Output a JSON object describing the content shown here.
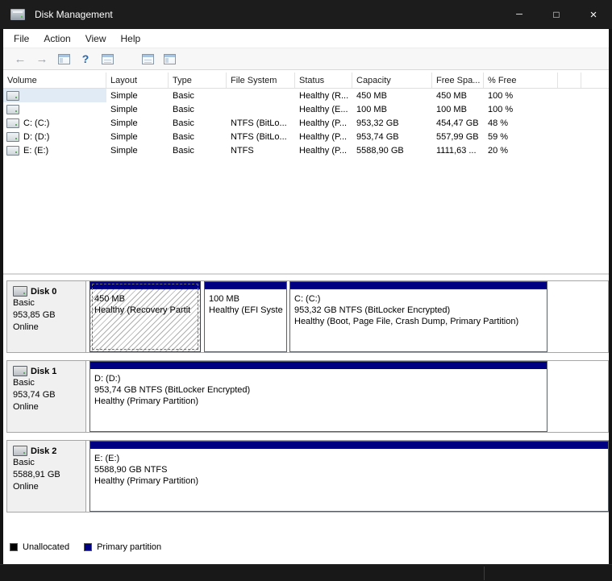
{
  "titlebar": {
    "title": "Disk Management",
    "minimize_glyph": "─",
    "maximize_glyph": "□",
    "close_glyph": "×"
  },
  "menubar": {
    "file": "File",
    "action": "Action",
    "view": "View",
    "help": "Help"
  },
  "toolbar": {
    "back_glyph": "←",
    "forward_glyph": "→",
    "help_glyph": "?",
    "icons": [
      "back-icon",
      "forward-icon",
      "console-tree-icon",
      "help-icon",
      "details-view-icon",
      "properties-icon",
      "action-pane-icon"
    ]
  },
  "volume_list": {
    "columns": {
      "volume": "Volume",
      "layout": "Layout",
      "type": "Type",
      "file_system": "File System",
      "status": "Status",
      "capacity": "Capacity",
      "free_space": "Free Spa...",
      "pct_free": "% Free"
    },
    "rows": [
      {
        "volume": "",
        "layout": "Simple",
        "type": "Basic",
        "file_system": "",
        "status": "Healthy (R...",
        "capacity": "450 MB",
        "free_space": "450 MB",
        "pct_free": "100 %"
      },
      {
        "volume": "",
        "layout": "Simple",
        "type": "Basic",
        "file_system": "",
        "status": "Healthy (E...",
        "capacity": "100 MB",
        "free_space": "100 MB",
        "pct_free": "100 %"
      },
      {
        "volume": "C: (C:)",
        "layout": "Simple",
        "type": "Basic",
        "file_system": "NTFS (BitLo...",
        "status": "Healthy (P...",
        "capacity": "953,32 GB",
        "free_space": "454,47 GB",
        "pct_free": "48 %"
      },
      {
        "volume": "D: (D:)",
        "layout": "Simple",
        "type": "Basic",
        "file_system": "NTFS (BitLo...",
        "status": "Healthy (P...",
        "capacity": "953,74 GB",
        "free_space": "557,99 GB",
        "pct_free": "59 %"
      },
      {
        "volume": "E: (E:)",
        "layout": "Simple",
        "type": "Basic",
        "file_system": "NTFS",
        "status": "Healthy (P...",
        "capacity": "5588,90 GB",
        "free_space": "1111,63 ...",
        "pct_free": "20 %"
      }
    ]
  },
  "disks": [
    {
      "name": "Disk 0",
      "kind": "Basic",
      "size": "953,85 GB",
      "status": "Online",
      "partitions": [
        {
          "line1": "450 MB",
          "line2": "Healthy (Recovery Partit"
        },
        {
          "line1": "100 MB",
          "line2": "Healthy (EFI Syste"
        },
        {
          "title": "C:  (C:)",
          "line1": "953,32 GB NTFS (BitLocker Encrypted)",
          "line2": "Healthy (Boot, Page File, Crash Dump, Primary Partition)"
        }
      ]
    },
    {
      "name": "Disk 1",
      "kind": "Basic",
      "size": "953,74 GB",
      "status": "Online",
      "partitions": [
        {
          "title": "D:  (D:)",
          "line1": "953,74 GB NTFS (BitLocker Encrypted)",
          "line2": "Healthy (Primary Partition)"
        }
      ]
    },
    {
      "name": "Disk 2",
      "kind": "Basic",
      "size": "5588,91 GB",
      "status": "Online",
      "partitions": [
        {
          "title": "E:  (E:)",
          "line1": "5588,90 GB NTFS",
          "line2": "Healthy (Primary Partition)"
        }
      ]
    }
  ],
  "legend": {
    "unallocated": "Unallocated",
    "primary": "Primary partition"
  },
  "colors": {
    "primary_partition": "#000082",
    "unallocated": "#000000",
    "titlebar_bg": "#1c1c1c",
    "selection_highlight": "#e1ebf5"
  }
}
